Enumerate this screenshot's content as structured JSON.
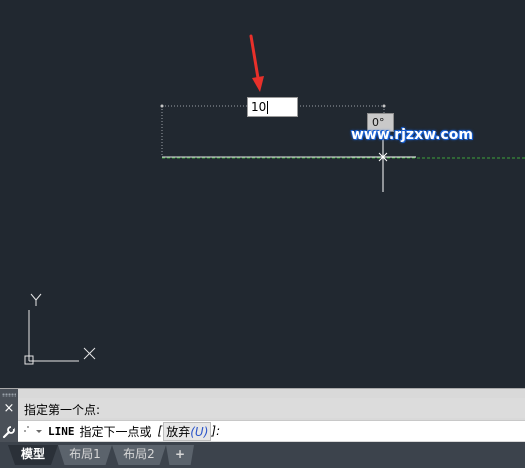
{
  "canvas": {
    "dynamic_input_value": "10",
    "angle_tooltip": "0°",
    "watermark": "www.rjzxw.com",
    "ucs": {
      "x_label": "X",
      "y_label": "Y"
    },
    "colors": {
      "background": "#212830",
      "polar_tracking": "#3da33d",
      "arrow": "#e8302a"
    }
  },
  "command": {
    "history_text": "指定第一个点:",
    "cmd_name": "LINE",
    "prompt_text": "指定下一点或",
    "option_open": "[",
    "option_label": "放弃",
    "option_key_open": "(",
    "option_key": "U",
    "option_key_close": ")",
    "option_close": "]:",
    "close_icon": "×"
  },
  "tabs": [
    {
      "label": "模型",
      "active": true
    },
    {
      "label": "布局1",
      "active": false
    },
    {
      "label": "布局2",
      "active": false
    },
    {
      "label": "+",
      "active": false
    }
  ]
}
